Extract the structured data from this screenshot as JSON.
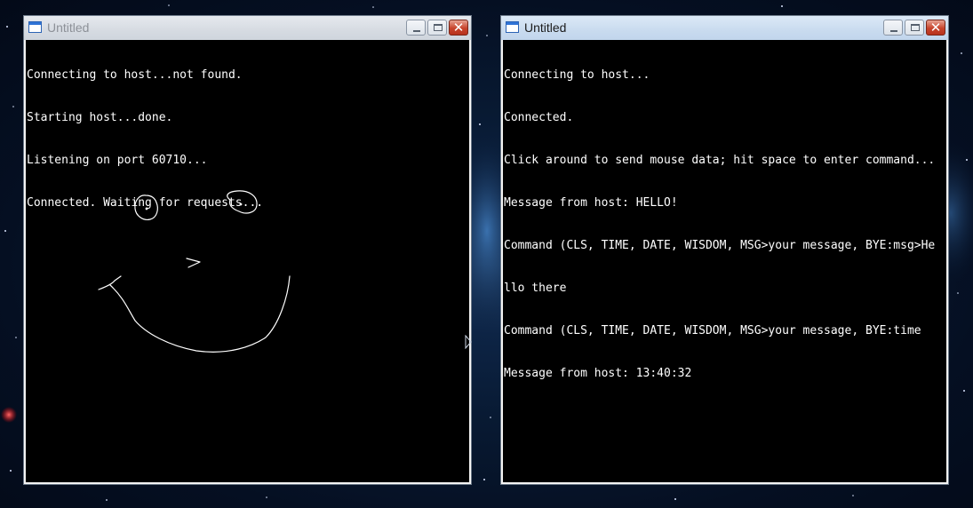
{
  "left_window": {
    "title": "Untitled",
    "active": false,
    "lines": [
      "Connecting to host...not found.",
      "Starting host...done.",
      "Listening on port 60710...",
      "Connected. Waiting for requests..."
    ]
  },
  "right_window": {
    "title": "Untitled",
    "active": true,
    "lines": [
      "Connecting to host...",
      "Connected.",
      "Click around to send mouse data; hit space to enter command...",
      "Message from host: HELLO!",
      "Command (CLS, TIME, DATE, WISDOM, MSG>your message, BYE:msg>He",
      "llo there",
      "Command (CLS, TIME, DATE, WISDOM, MSG>your message, BYE:time",
      "Message from host: 13:40:32"
    ]
  },
  "icons": {
    "app_icon": "window-app-icon",
    "minimize": "minimize-icon",
    "maximize": "maximize-icon",
    "close": "close-icon"
  },
  "colors": {
    "console_bg": "#000000",
    "console_text": "#ffffff",
    "close_button": "#c7442c"
  }
}
